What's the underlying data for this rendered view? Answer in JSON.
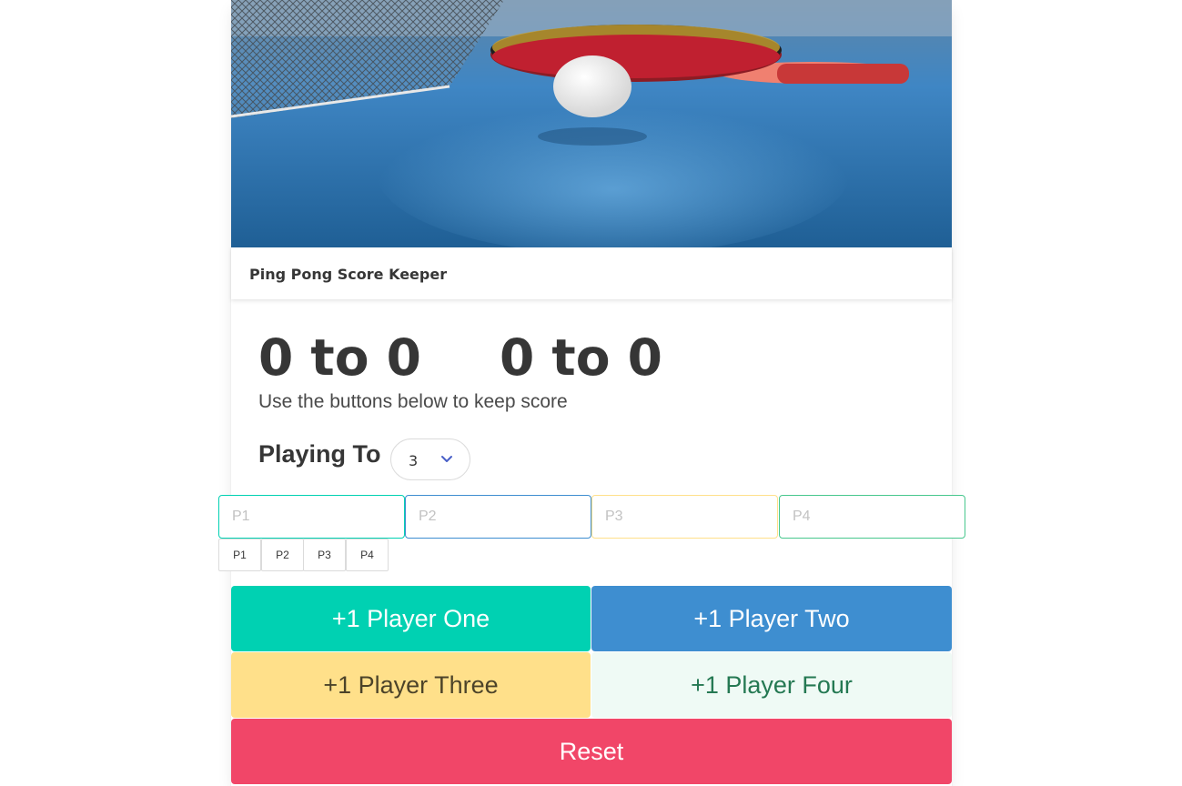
{
  "header": {
    "title": "Ping Pong Score Keeper"
  },
  "scores": {
    "match1": "0 to 0",
    "match2": "0 to 0"
  },
  "subtitle": "Use the buttons below to keep score",
  "playing_to": {
    "label": "Playing To",
    "value": "3"
  },
  "inputs": [
    {
      "placeholder": "P1",
      "value": ""
    },
    {
      "placeholder": "P2",
      "value": ""
    },
    {
      "placeholder": "P3",
      "value": ""
    },
    {
      "placeholder": "P4",
      "value": ""
    }
  ],
  "small_buttons": [
    "P1",
    "P2",
    "P3",
    "P4"
  ],
  "buttons": {
    "player_one": "+1 Player One",
    "player_two": "+1 Player Two",
    "player_three": "+1 Player Three",
    "player_four": "+1 Player Four",
    "reset": "Reset"
  },
  "colors": {
    "player_one": "#00d1b2",
    "player_two": "#3e8ed0",
    "player_three": "#ffe08a",
    "player_four": "#effaf5",
    "reset": "#f14668"
  }
}
